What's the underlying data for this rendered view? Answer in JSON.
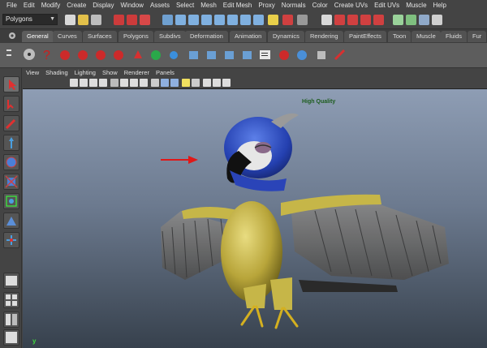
{
  "menu": [
    "File",
    "Edit",
    "Modify",
    "Create",
    "Display",
    "Window",
    "Assets",
    "Select",
    "Mesh",
    "Edit Mesh",
    "Proxy",
    "Normals",
    "Color",
    "Create UVs",
    "Edit UVs",
    "Muscle",
    "Help"
  ],
  "status_line": {
    "mode": "Polygons"
  },
  "shelf": {
    "tabs": [
      "General",
      "Curves",
      "Surfaces",
      "Polygons",
      "Subdivs",
      "Deformation",
      "Animation",
      "Dynamics",
      "Rendering",
      "PaintEffects",
      "Toon",
      "Muscle",
      "Fluids",
      "Fur"
    ],
    "active_tab": "General"
  },
  "panel": {
    "menu": [
      "View",
      "Shading",
      "Lighting",
      "Show",
      "Renderer",
      "Panels"
    ],
    "renderer_label": "High Quality",
    "axis_label": "y"
  },
  "colors": {
    "accent_red": "#e01818",
    "parrot_blue": "#2b4fc4",
    "parrot_yellow": "#c8b84a",
    "wing_gray": "#6a6a6a"
  }
}
